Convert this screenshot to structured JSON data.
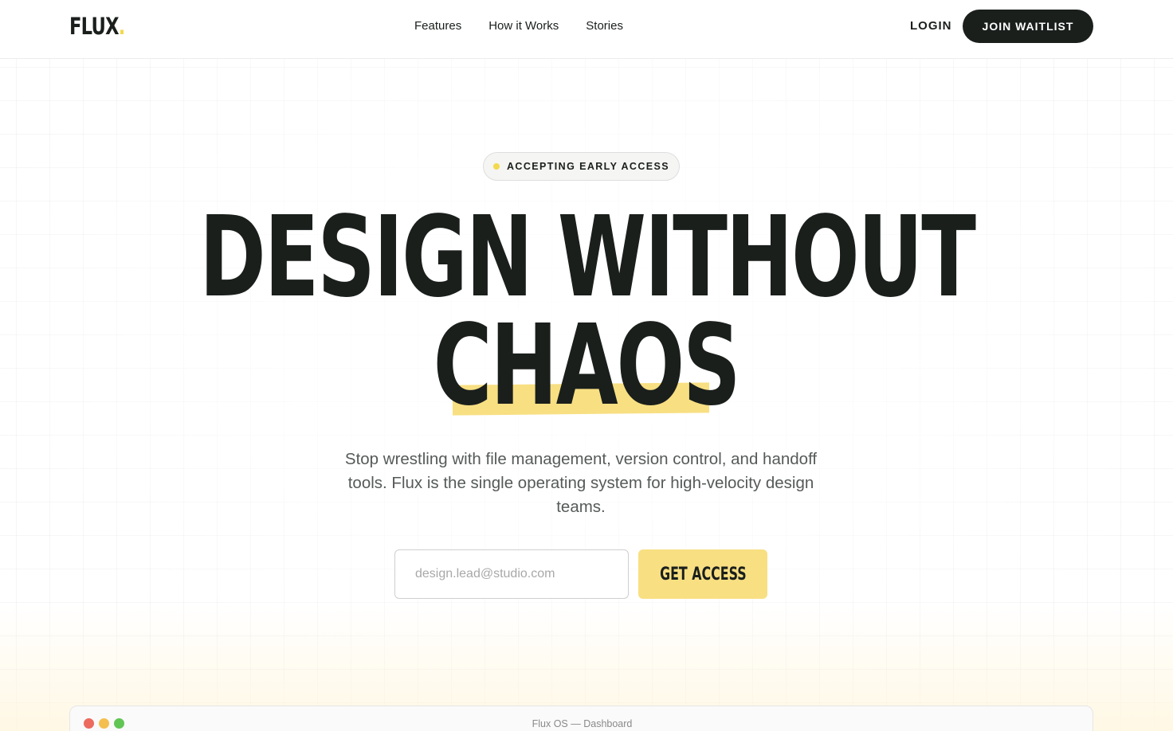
{
  "header": {
    "logo": "FLUX",
    "logo_dot": ".",
    "nav": [
      "Features",
      "How it Works",
      "Stories"
    ],
    "login": "LOGIN",
    "join": "JOIN WAITLIST"
  },
  "hero": {
    "badge": "ACCEPTING EARLY ACCESS",
    "headline_line1": "DESIGN WITHOUT",
    "headline_line2": "CHAOS",
    "subtext": "Stop wrestling with file management, version control, and handoff tools. Flux is the single operating system for high-velocity design teams.",
    "email_placeholder": "design.lead@studio.com",
    "cta": "GET ACCESS"
  },
  "preview_window": {
    "title": "Flux OS — Dashboard",
    "dot_colors": [
      "#ec6a5e",
      "#f4bf4f",
      "#61c554"
    ]
  },
  "colors": {
    "accent": "#f8df82",
    "dark": "#1a1f1c"
  }
}
